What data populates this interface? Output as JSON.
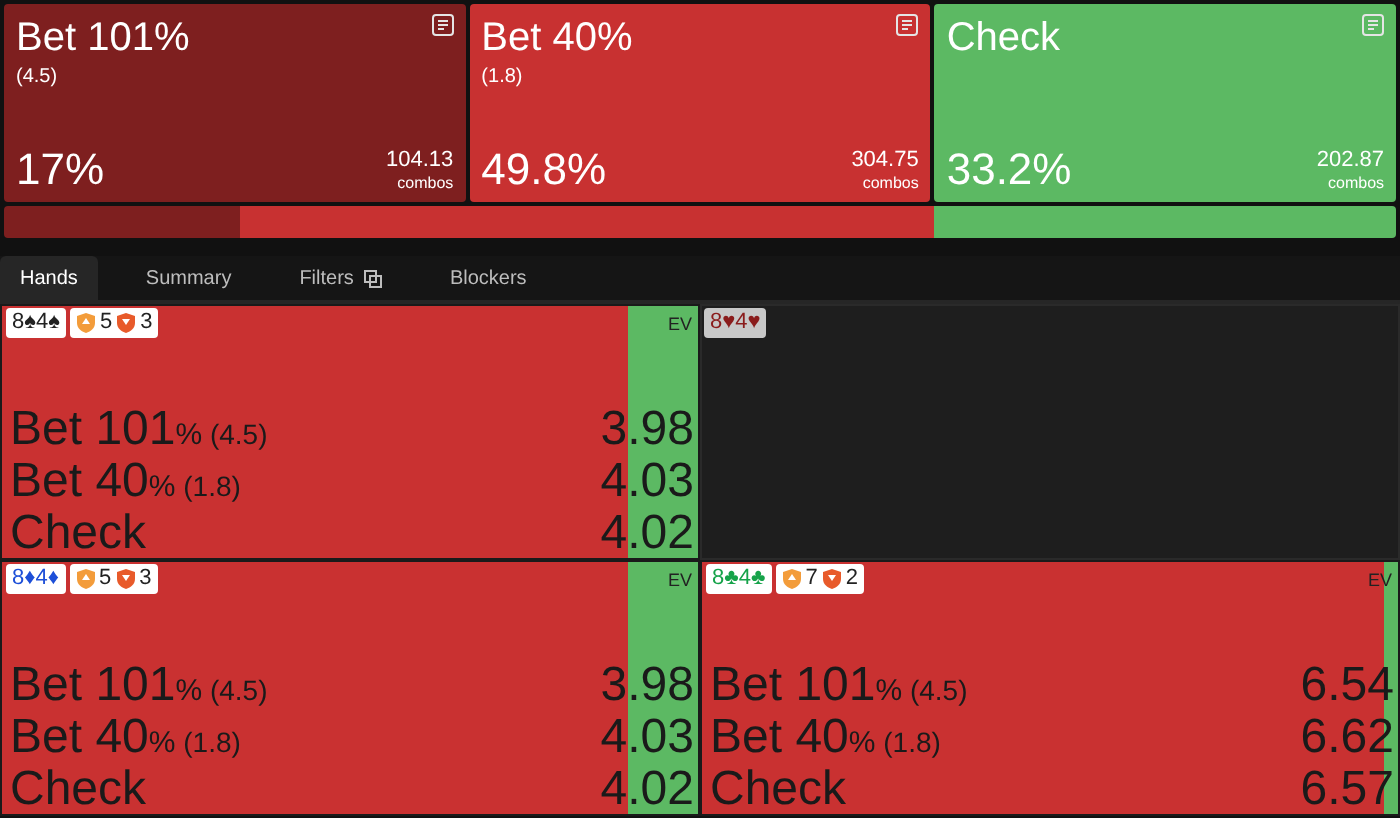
{
  "actions": [
    {
      "title": "Bet 101%",
      "size": "(4.5)",
      "frequency": "17%",
      "combos": "104.13",
      "combos_label": "combos",
      "color": "#7e1f1f"
    },
    {
      "title": "Bet 40%",
      "size": "(1.8)",
      "frequency": "49.8%",
      "combos": "304.75",
      "combos_label": "combos",
      "color": "#c83131"
    },
    {
      "title": "Check",
      "frequency": "33.2%",
      "combos": "202.87",
      "combos_label": "combos",
      "color": "#5cb963"
    }
  ],
  "tabs": [
    {
      "label": "Hands",
      "selected": true
    },
    {
      "label": "Summary",
      "selected": false
    },
    {
      "label": "Filters",
      "selected": false,
      "icon": true
    },
    {
      "label": "Blockers",
      "selected": false
    }
  ],
  "hands": [
    {
      "cards": [
        {
          "rank": "8",
          "suit": "♠",
          "color": "#222222"
        },
        {
          "rank": "4",
          "suit": "♠",
          "color": "#222222"
        }
      ],
      "badges": [
        "5",
        "3"
      ],
      "ev_label": "EV",
      "level": 0.1,
      "rows": [
        {
          "name": "Bet 101",
          "unit": "%",
          "size": "(4.5)",
          "value": "3.98"
        },
        {
          "name": "Bet 40",
          "unit": "%",
          "size": "(1.8)",
          "value": "4.03"
        },
        {
          "name": "Check",
          "value": "4.02"
        }
      ]
    },
    {
      "cards": [
        {
          "rank": "8",
          "suit": "♥",
          "color": "#8a1c1c"
        },
        {
          "rank": "4",
          "suit": "♥",
          "color": "#8a1c1c"
        }
      ],
      "empty": true
    },
    {
      "cards": [
        {
          "rank": "8",
          "suit": "♦",
          "color": "#1d4fd8"
        },
        {
          "rank": "4",
          "suit": "♦",
          "color": "#1d4fd8"
        }
      ],
      "badges": [
        "5",
        "3"
      ],
      "ev_label": "EV",
      "level": 0.1,
      "rows": [
        {
          "name": "Bet 101",
          "unit": "%",
          "size": "(4.5)",
          "value": "3.98"
        },
        {
          "name": "Bet 40",
          "unit": "%",
          "size": "(1.8)",
          "value": "4.03"
        },
        {
          "name": "Check",
          "value": "4.02"
        }
      ]
    },
    {
      "cards": [
        {
          "rank": "8",
          "suit": "♣",
          "color": "#16a34a"
        },
        {
          "rank": "4",
          "suit": "♣",
          "color": "#16a34a"
        }
      ],
      "badges": [
        "7",
        "2"
      ],
      "ev_label": "EV",
      "level": 0.02,
      "rows": [
        {
          "name": "Bet 101",
          "unit": "%",
          "size": "(4.5)",
          "value": "6.54"
        },
        {
          "name": "Bet 40",
          "unit": "%",
          "size": "(1.8)",
          "value": "6.62"
        },
        {
          "name": "Check",
          "value": "6.57"
        }
      ]
    }
  ]
}
